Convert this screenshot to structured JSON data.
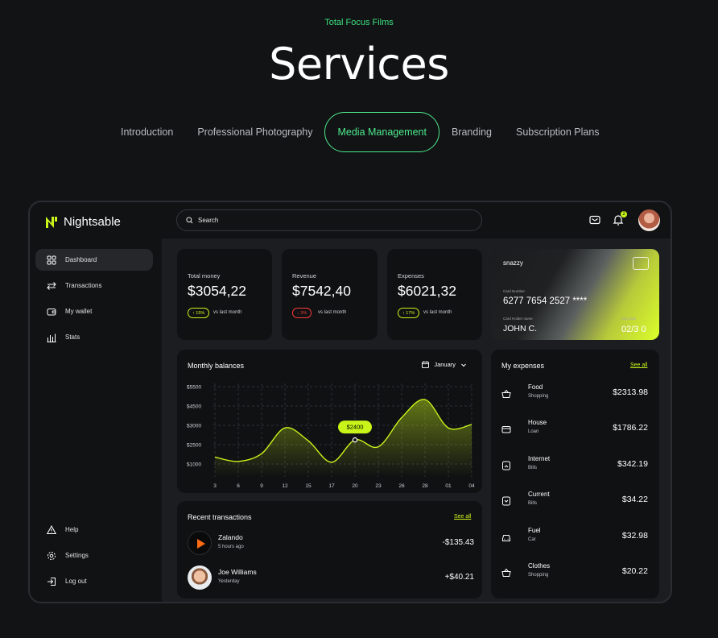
{
  "header": {
    "subtitle": "Total Focus Films",
    "title": "Services",
    "tabs": [
      {
        "label": "Introduction",
        "active": false
      },
      {
        "label": "Professional Photography",
        "active": false
      },
      {
        "label": "Media Management",
        "active": true
      },
      {
        "label": "Branding",
        "active": false
      },
      {
        "label": "Subscription Plans",
        "active": false
      }
    ]
  },
  "app": {
    "name": "Nightsable",
    "search_placeholder": "Search",
    "notification_count": "2",
    "accent_color": "#c8f41a"
  },
  "sidebar": {
    "items": [
      {
        "label": "Dashboard",
        "icon": "grid-icon",
        "active": true
      },
      {
        "label": "Transactions",
        "icon": "arrows-icon",
        "active": false
      },
      {
        "label": "My wallet",
        "icon": "wallet-icon",
        "active": false
      },
      {
        "label": "Stats",
        "icon": "bar-chart-icon",
        "active": false
      }
    ],
    "bottom": [
      {
        "label": "Help",
        "icon": "warning-icon"
      },
      {
        "label": "Settings",
        "icon": "gear-icon"
      },
      {
        "label": "Log out",
        "icon": "logout-icon"
      }
    ]
  },
  "stats": [
    {
      "label": "Total money",
      "value": "$3054,22",
      "change": "↑ 15%",
      "direction": "up",
      "note": "vs last month"
    },
    {
      "label": "Revenue",
      "value": "$7542,40",
      "change": "↓ 3%",
      "direction": "down",
      "note": "vs last month"
    },
    {
      "label": "Expenses",
      "value": "$6021,32",
      "change": "↑ 17%",
      "direction": "up",
      "note": "vs last month"
    }
  ],
  "credit_card": {
    "brand": "snazzy",
    "number_label": "Card Number",
    "number": "6277 7654 2527 ****",
    "holder_label": "Card Holder name",
    "holder": "JOHN C.",
    "expiry_label": "Exp Date",
    "expiry": "02/3 0"
  },
  "monthly": {
    "title": "Monthly balances",
    "month": "January",
    "tooltip": "$2400"
  },
  "chart_data": {
    "type": "area",
    "title": "Monthly balances",
    "x": [
      "3",
      "6",
      "9",
      "12",
      "15",
      "17",
      "20",
      "23",
      "26",
      "28",
      "01",
      "04"
    ],
    "y_ticks": [
      "$5500",
      "$4500",
      "$3000",
      "$2500",
      "$1000"
    ],
    "series": [
      {
        "values": [
          1400,
          1150,
          1600,
          3100,
          2350,
          1100,
          2400,
          2000,
          3700,
          4750,
          3100,
          3300
        ]
      }
    ],
    "highlight": {
      "x": "20",
      "value": 2400,
      "label": "$2400"
    },
    "grid": true
  },
  "expenses": {
    "title": "My expenses",
    "see_all": "See all",
    "items": [
      {
        "name": "Food",
        "category": "Shopping",
        "amount": "$2313.98",
        "icon": "basket-icon"
      },
      {
        "name": "House",
        "category": "Loan",
        "amount": "$1786.22",
        "icon": "card-icon"
      },
      {
        "name": "Internet",
        "category": "Bills",
        "amount": "$342.19",
        "icon": "bill-icon"
      },
      {
        "name": "Current",
        "category": "Bills",
        "amount": "$34.22",
        "icon": "bill-icon"
      },
      {
        "name": "Fuel",
        "category": "Car",
        "amount": "$32.98",
        "icon": "car-icon"
      },
      {
        "name": "Clothes",
        "category": "Shopping",
        "amount": "$20.22",
        "icon": "basket-icon"
      }
    ]
  },
  "transactions": {
    "title": "Recent transactions",
    "see_all": "See all",
    "items": [
      {
        "name": "Zalando",
        "time": "5 hours ago",
        "amount": "-$135.43"
      },
      {
        "name": "Joe Williams",
        "time": "Yesterday",
        "amount": "+$40.21"
      }
    ]
  }
}
